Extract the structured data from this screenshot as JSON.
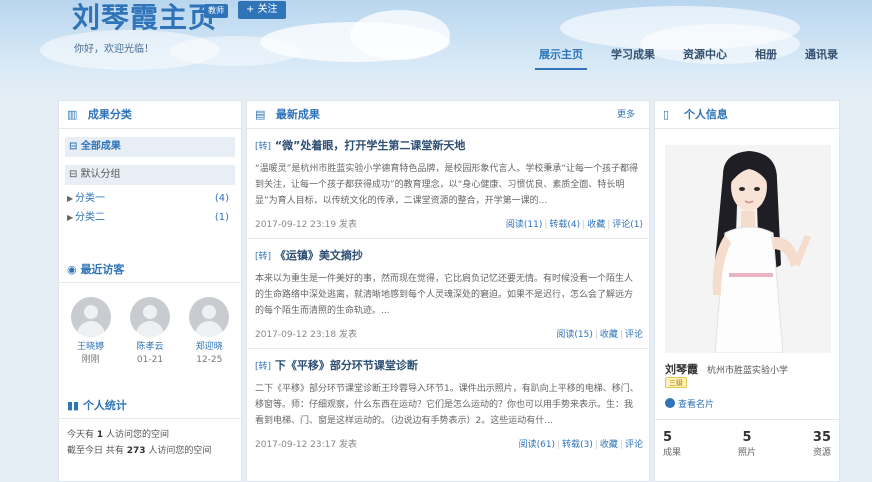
{
  "header": {
    "title": "刘琴霞主页",
    "badge": "教师",
    "follow_label": "+ 关注",
    "welcome": "你好，欢迎光临！"
  },
  "nav": {
    "items": [
      {
        "label": "展示主页"
      },
      {
        "label": "学习成果"
      },
      {
        "label": "资源中心"
      },
      {
        "label": "相册"
      },
      {
        "label": "通讯录"
      }
    ]
  },
  "categories": {
    "title": "成果分类",
    "all_label": "全部成果",
    "default_label": "默认分组",
    "items": [
      {
        "label": "分类一",
        "count": "(4)"
      },
      {
        "label": "分类二",
        "count": "(1)"
      }
    ]
  },
  "visitors": {
    "title": "最近访客",
    "items": [
      {
        "name": "王晓婷",
        "date": "刚刚"
      },
      {
        "name": "陈孝云",
        "date": "01-21"
      },
      {
        "name": "郑迎晓",
        "date": "12-25"
      }
    ]
  },
  "stats": {
    "title": "个人统计",
    "today_prefix": "今天有",
    "today_count": "1",
    "today_suffix": "人访问您的空间",
    "total_prefix": "截至今日 共有",
    "total_count": "273",
    "total_suffix": "人访问您的空间"
  },
  "latest": {
    "title": "最新成果",
    "more": "更多",
    "articles": [
      {
        "tag": "[转]",
        "title": "“微”处着眼，打开学生第二课堂新天地",
        "body": "“温暖灵”是杭州市胜蓝实验小学德育特色品牌，是校园形象代言人。学校秉承“让每一个孩子都得到关注，让每一个孩子都获得成功”的教育理念，以“身心健康、习惯优良、素质全面、特长明显”为育人目标，以传统文化的传承，二课堂资源的整合，开学第一课的...",
        "time": "2017-09-12 23:19",
        "posted": "发表",
        "actions": [
          "阅读(11)",
          "转载(4)",
          "收藏",
          "评论(1)"
        ]
      },
      {
        "tag": "[转]",
        "title": "《运镇》美文摘抄",
        "body": "本来以为重生是一件美好的事，然而现在觉得，它比肩负记忆还要无情。有时候没看一个陌生人的生命路络中深处逃离，就清晰地感到每个人灵魂深处的窘迫。如果不是迟行，怎么会了解远方的每个陌生而清照的生命轨迹。...",
        "time": "2017-09-12 23:18",
        "posted": "发表",
        "actions": [
          "阅读(15)",
          "收藏",
          "评论"
        ]
      },
      {
        "tag": "[转]",
        "title": "下《平移》部分环节课堂诊断",
        "body": "二下《平移》部分环节课堂诊断王玲蓉导入环节1。课件出示照片，有趴向上平移的电梯、移门、移窗等。师：仔细观察，什么东西在运动？它们是怎么运动的？你也可以用手势来表示。生：我看到电梯、门、窗是这样运动的。（边说边有手势表示）2。这些运动有什...",
        "time": "2017-09-12 23:17",
        "posted": "发表",
        "actions": [
          "阅读(61)",
          "转载(3)",
          "收藏",
          "评论"
        ]
      }
    ]
  },
  "profile": {
    "title": "个人信息",
    "name": "刘琴霞",
    "school": "杭州市胜蓝实验小学",
    "level": "三级",
    "card_link": "查看名片",
    "counts": [
      {
        "num": "5",
        "label": "成果"
      },
      {
        "num": "5",
        "label": "照片"
      },
      {
        "num": "35",
        "label": "资源"
      }
    ]
  },
  "colors": {
    "accent": "#2f74b8",
    "banner_top": "#b9d6ef"
  }
}
